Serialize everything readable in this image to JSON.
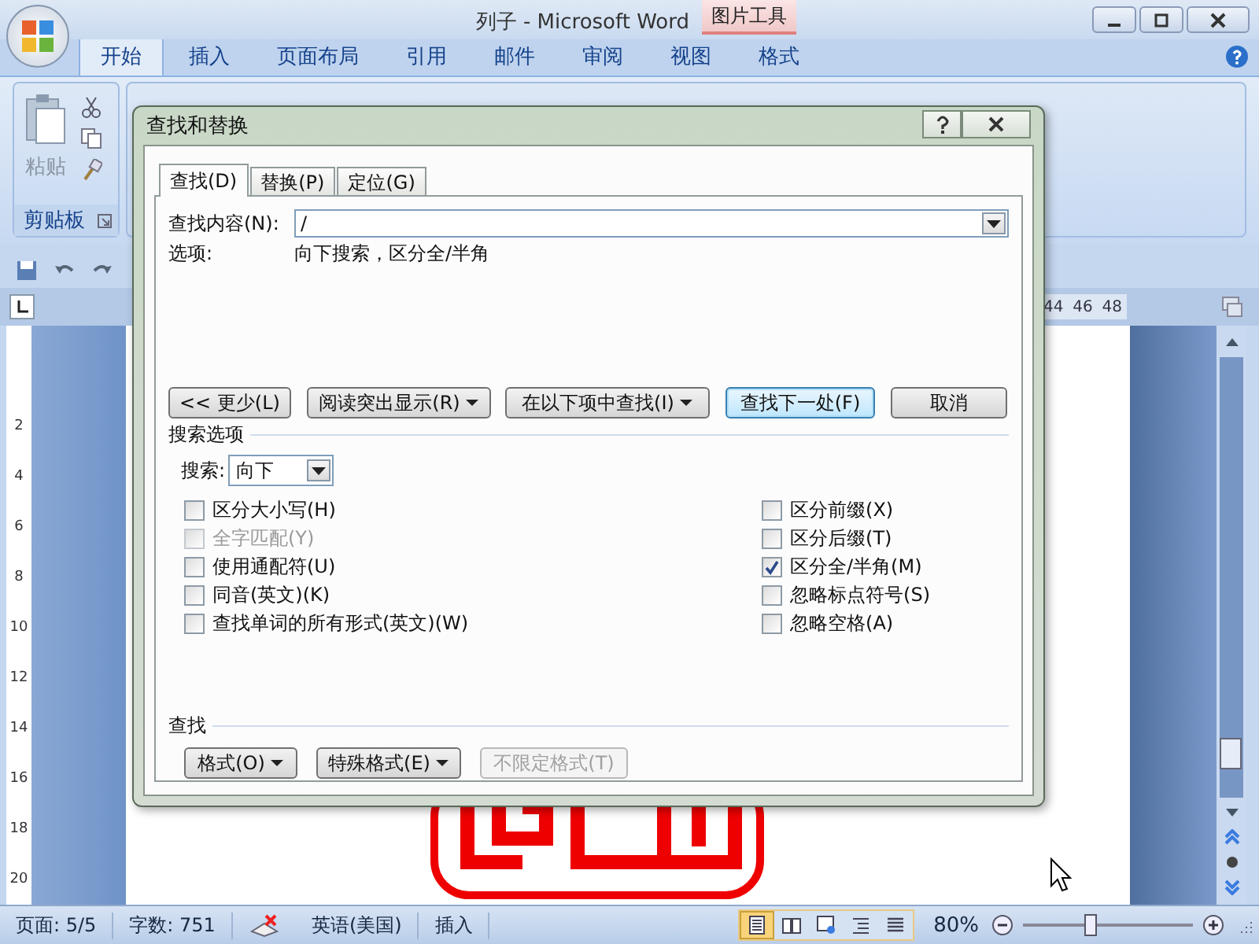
{
  "window": {
    "title": "列子 - Microsoft Word",
    "context_tab": "图片工具"
  },
  "ribbon_tabs": [
    {
      "label": "开始",
      "selected": true
    },
    {
      "label": "插入",
      "selected": false
    },
    {
      "label": "页面布局",
      "selected": false
    },
    {
      "label": "引用",
      "selected": false
    },
    {
      "label": "邮件",
      "selected": false
    },
    {
      "label": "审阅",
      "selected": false
    },
    {
      "label": "视图",
      "selected": false
    },
    {
      "label": "格式",
      "selected": false
    }
  ],
  "clipboard": {
    "paste": "粘贴",
    "group": "剪贴板"
  },
  "ruler": {
    "top_numbers": [
      "44",
      "46",
      "48"
    ],
    "side_numbers": [
      "2",
      "4",
      "6",
      "8",
      "10",
      "12",
      "14",
      "16",
      "18",
      "20"
    ]
  },
  "dialog": {
    "title": "查找和替换",
    "tabs": [
      {
        "label": "查找(D)",
        "selected": true
      },
      {
        "label": "替换(P)",
        "selected": false
      },
      {
        "label": "定位(G)",
        "selected": false
      }
    ],
    "find_label": "查找内容(N):",
    "find_value": "/",
    "options_label": "选项:",
    "options_value": "向下搜索，区分全/半角",
    "buttons": [
      {
        "label": "<< 更少(L)",
        "dropdown": false,
        "default": false
      },
      {
        "label": "阅读突出显示(R)",
        "dropdown": true,
        "default": false
      },
      {
        "label": "在以下项中查找(I)",
        "dropdown": true,
        "default": false
      },
      {
        "label": "查找下一处(F)",
        "dropdown": false,
        "default": true
      },
      {
        "label": "取消",
        "dropdown": false,
        "default": false
      }
    ],
    "search_options_title": "搜索选项",
    "direction_label": "搜索:",
    "direction_value": "向下",
    "left_options": [
      {
        "label": "区分大小写(H)",
        "checked": false,
        "disabled": false
      },
      {
        "label": "全字匹配(Y)",
        "checked": false,
        "disabled": true
      },
      {
        "label": "使用通配符(U)",
        "checked": false,
        "disabled": false
      },
      {
        "label": "同音(英文)(K)",
        "checked": false,
        "disabled": false
      },
      {
        "label": "查找单词的所有形式(英文)(W)",
        "checked": false,
        "disabled": false
      }
    ],
    "right_options": [
      {
        "label": "区分前缀(X)",
        "checked": false,
        "disabled": false
      },
      {
        "label": "区分后缀(T)",
        "checked": false,
        "disabled": false
      },
      {
        "label": "区分全/半角(M)",
        "checked": true,
        "disabled": false
      },
      {
        "label": "忽略标点符号(S)",
        "checked": false,
        "disabled": false
      },
      {
        "label": "忽略空格(A)",
        "checked": false,
        "disabled": false
      }
    ],
    "find_section_title": "查找",
    "format_buttons": [
      {
        "label": "格式(O)",
        "dropdown": true,
        "disabled": false
      },
      {
        "label": "特殊格式(E)",
        "dropdown": true,
        "disabled": false
      },
      {
        "label": "不限定格式(T)",
        "dropdown": false,
        "disabled": true
      }
    ]
  },
  "status_bar": {
    "page": "页面: 5/5",
    "words": "字数: 751",
    "language": "英语(美国)",
    "mode": "插入",
    "views": [
      {
        "kind": "print",
        "selected": true
      },
      {
        "kind": "reading",
        "selected": false
      },
      {
        "kind": "web",
        "selected": false
      },
      {
        "kind": "outline",
        "selected": false
      },
      {
        "kind": "draft",
        "selected": false
      }
    ],
    "zoom": "80%",
    "zoom_slider": {
      "level": 0.4
    }
  }
}
